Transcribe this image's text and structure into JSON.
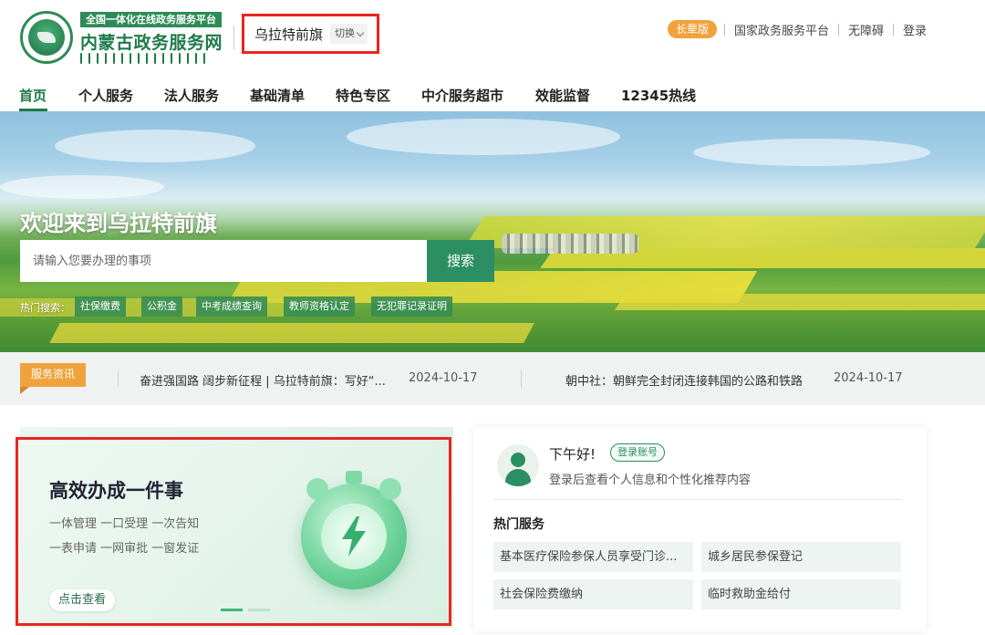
{
  "header": {
    "platform_badge": "全国一体化在线政务服务平台",
    "site_name": "内蒙古政务服务网",
    "region": "乌拉特前旗",
    "switch_label": "切换",
    "elder_version": "长辈版",
    "links": [
      "国家政务服务平台",
      "无障碍",
      "登录"
    ]
  },
  "nav": {
    "items": [
      "首页",
      "个人服务",
      "法人服务",
      "基础清单",
      "特色专区",
      "中介服务超市",
      "效能监督",
      "12345热线"
    ]
  },
  "banner": {
    "welcome": "欢迎来到乌拉特前旗",
    "search_placeholder": "请输入您要办理的事项",
    "search_button": "搜索",
    "hot_label": "热门搜索：",
    "hot_tags": [
      "社保缴费",
      "公积金",
      "中考成绩查询",
      "教师资格认定",
      "无犯罪记录证明"
    ]
  },
  "news": {
    "tag": "服务资讯",
    "items": [
      {
        "title": "奋进强国路 阔步新征程 | 乌拉特前旗：写好“...",
        "date": "2024-10-17"
      },
      {
        "title": "朝中社：朝鲜完全封闭连接韩国的公路和铁路",
        "date": "2024-10-17"
      }
    ]
  },
  "promo": {
    "title": "高效办成一件事",
    "line1": "一体管理 一口受理 一次告知",
    "line2": "一表申请 一网审批 一窗发证",
    "button": "点击查看"
  },
  "user_panel": {
    "greeting": "下午好!",
    "login_button": "登录账号",
    "hint": "登录后查看个人信息和个性化推荐内容",
    "hot_services_title": "热门服务",
    "services": [
      "基本医疗保险参保人员享受门诊...",
      "城乡居民参保登记",
      "社会保险费缴纳",
      "临时救助金给付"
    ]
  },
  "colors": {
    "brand_green": "#1d7a4a",
    "accent_orange": "#f0a33c",
    "highlight_red": "#e8261e"
  }
}
